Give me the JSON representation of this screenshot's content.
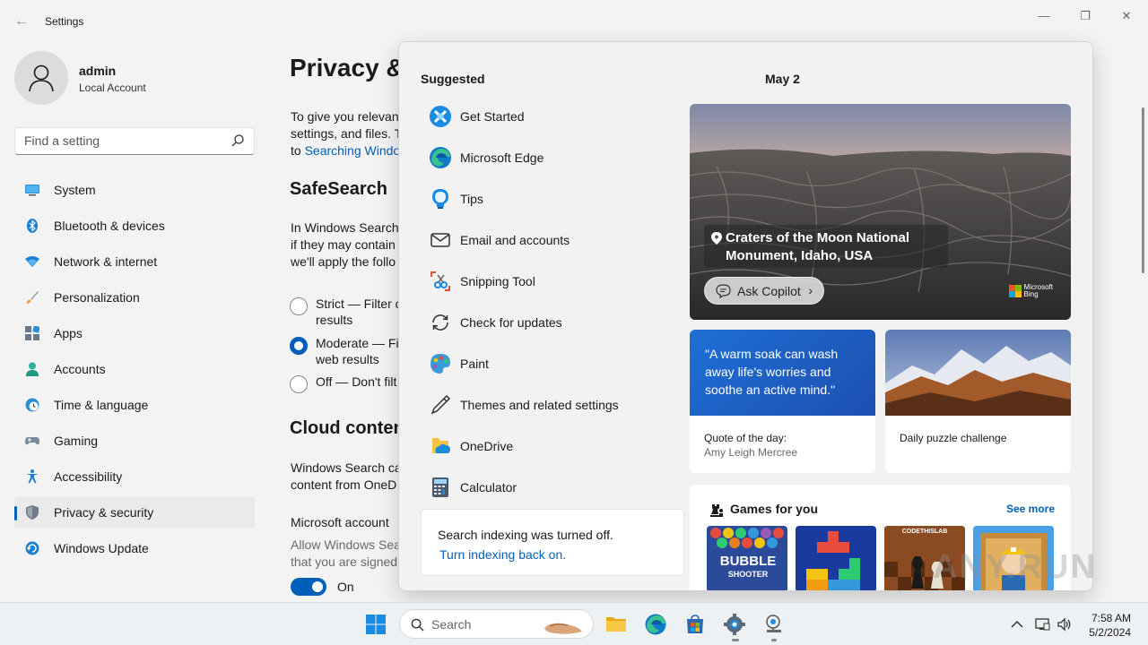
{
  "window": {
    "title": "Settings",
    "back_icon": "back-arrow-icon",
    "minimize_icon": "minimize-icon",
    "restore_icon": "restore-icon",
    "close_icon": "close-icon"
  },
  "profile": {
    "name": "admin",
    "account_type": "Local Account",
    "avatar_icon": "user-icon"
  },
  "find_setting": {
    "placeholder": "Find a setting",
    "icon": "search-icon"
  },
  "nav": {
    "items": [
      {
        "label": "System",
        "icon": "system-icon"
      },
      {
        "label": "Bluetooth & devices",
        "icon": "bluetooth-icon"
      },
      {
        "label": "Network & internet",
        "icon": "wifi-icon"
      },
      {
        "label": "Personalization",
        "icon": "brush-icon"
      },
      {
        "label": "Apps",
        "icon": "apps-icon"
      },
      {
        "label": "Accounts",
        "icon": "accounts-icon"
      },
      {
        "label": "Time & language",
        "icon": "globe-clock-icon"
      },
      {
        "label": "Gaming",
        "icon": "gamepad-icon"
      },
      {
        "label": "Accessibility",
        "icon": "accessibility-icon"
      },
      {
        "label": "Privacy & security",
        "icon": "shield-icon",
        "active": true
      },
      {
        "label": "Windows Update",
        "icon": "update-icon"
      }
    ]
  },
  "content": {
    "page_title": "Privacy &",
    "intro_line1": "To give you relevant",
    "intro_line2": "settings, and files. T",
    "intro_line3_prefix": "to ",
    "intro_link": "Searching Windo",
    "safesearch_heading": "SafeSearch",
    "safesearch_line1": "In Windows Search,",
    "safesearch_line2": "if they may contain",
    "safesearch_line3": "we'll apply the follo",
    "radio_strict": "Strict — Filter c",
    "radio_strict_line2": "results",
    "radio_moderate": "Moderate — Fi",
    "radio_moderate_line2": "web results",
    "radio_off": "Off — Don't filt",
    "radio_selected": "Moderate",
    "cloud_heading": "Cloud conten",
    "cloud_line1": "Windows Search ca",
    "cloud_line2": "content from OneD",
    "ms_account_label": "Microsoft account",
    "ms_account_desc1": "Allow Windows Sea",
    "ms_account_desc2": "that you are signed",
    "toggle_state": "On"
  },
  "flyout": {
    "suggested_heading": "Suggested",
    "suggested": [
      {
        "label": "Get Started",
        "icon": "get-started-icon"
      },
      {
        "label": "Microsoft Edge",
        "icon": "edge-icon"
      },
      {
        "label": "Tips",
        "icon": "tips-icon"
      },
      {
        "label": "Email and accounts",
        "icon": "mail-icon"
      },
      {
        "label": "Snipping Tool",
        "icon": "snipping-tool-icon"
      },
      {
        "label": "Check for updates",
        "icon": "refresh-icon"
      },
      {
        "label": "Paint",
        "icon": "paint-icon"
      },
      {
        "label": "Themes and related settings",
        "icon": "pen-icon"
      },
      {
        "label": "OneDrive",
        "icon": "onedrive-icon"
      },
      {
        "label": "Calculator",
        "icon": "calculator-icon"
      }
    ],
    "indexing_message": "Search indexing was turned off.",
    "indexing_link": "Turn indexing back on.",
    "date": "May 2",
    "hero": {
      "location_line1": "Craters of the Moon National",
      "location_line2": "Monument, Idaho, USA",
      "ask_copilot": "Ask Copilot",
      "bing_line1": "Microsoft",
      "bing_line2": "Bing"
    },
    "quote_card": {
      "quote": "\"A warm soak can wash away life's worries and soothe an active mind.\"",
      "label": "Quote of the day:",
      "author": "Amy Leigh Mercree"
    },
    "puzzle_card": {
      "label": "Daily puzzle challenge"
    },
    "games": {
      "heading": "Games for you",
      "see_more": "See more",
      "tile1_text": "BUBBLE",
      "tile1_text2": "SHOOTER",
      "tile3_text": "CODETHISLAB"
    }
  },
  "taskbar": {
    "search_placeholder": "Search",
    "time": "7:58 AM",
    "date": "5/2/2024",
    "apps": [
      "start-icon",
      "file-explorer-icon",
      "edge-icon",
      "store-icon",
      "settings-gear-icon",
      "system-app-icon"
    ],
    "tray": [
      "chevron-up-icon",
      "network-icon",
      "volume-icon"
    ]
  },
  "colors": {
    "accent": "#005fb8",
    "quote_blue": "#1f6fd6"
  },
  "watermark": "ANY.RUN"
}
